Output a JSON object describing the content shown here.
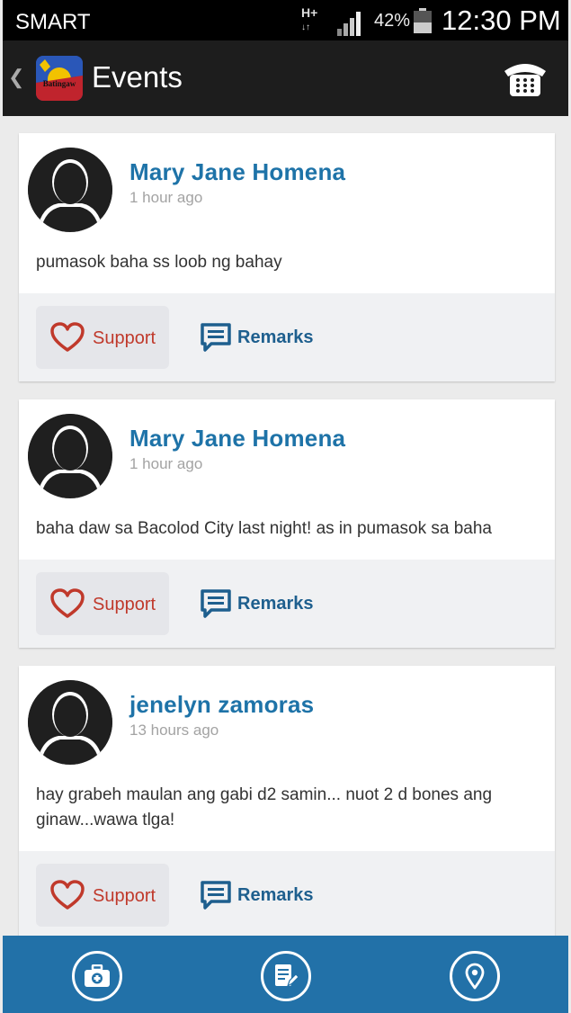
{
  "status_bar": {
    "carrier": "SMART",
    "network": "H+",
    "battery_percent": "42%",
    "time": "12:30 PM"
  },
  "app_bar": {
    "logo_text": "Batingaw",
    "title": "Events"
  },
  "posts": [
    {
      "author": "Mary Jane Homena",
      "time": "1 hour ago",
      "text": "pumasok baha ss loob ng bahay",
      "support_label": "Support",
      "remarks_label": "Remarks"
    },
    {
      "author": "Mary Jane Homena",
      "time": "1 hour ago",
      "text": "baha daw sa Bacolod City last night! as in pumasok sa baha",
      "support_label": "Support",
      "remarks_label": "Remarks"
    },
    {
      "author": "jenelyn zamoras",
      "time": "13 hours ago",
      "text": "hay grabeh maulan ang gabi d2 samin... nuot 2 d bones ang ginaw...wawa tlga!",
      "support_label": "Support",
      "remarks_label": "Remarks"
    }
  ],
  "bottom_nav": {
    "items": [
      {
        "icon": "first-aid-kit-icon"
      },
      {
        "icon": "report-edit-icon"
      },
      {
        "icon": "location-pin-icon"
      }
    ]
  },
  "colors": {
    "accent_blue": "#1e73a8",
    "support_red": "#c0392b",
    "bottom_bar": "#2271a8"
  }
}
